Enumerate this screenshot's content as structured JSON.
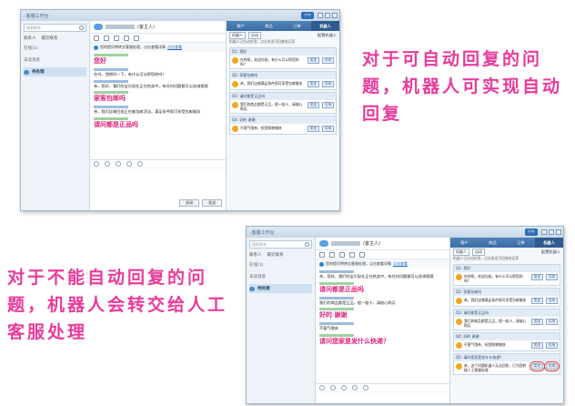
{
  "caption_top": "对于可自动回复的问题，机器人可实现自动回复",
  "caption_bottom": "对于不能自动回复的问题，机器人会转交给人工客服处理",
  "window1": {
    "title": "·客服工作台",
    "brand": "千牛",
    "sidebar": {
      "search_placeholder": "搜索联系",
      "tab_contacts": "联系人",
      "tab_recent": "最近联系",
      "items": [
        {
          "label": "在线(1)"
        },
        {
          "label": "未读消息"
        },
        {
          "label": "待处理"
        }
      ]
    },
    "chat": {
      "header_suffix": "(客主人)",
      "notice": "您的提问将转交客服处理，点击查看详情",
      "notice_link": "点击查看",
      "messages": [
        {
          "text": "您好",
          "big": true
        },
        {
          "text": "在吗，我想问一下，有什么可以帮您的吗？",
          "big": false
        },
        {
          "text": "亲，您好，我们的宝贝现在正在热卖中，有任何问题都可以咨询我哦",
          "big": false
        },
        {
          "text": "家客包邮吗",
          "big": true
        },
        {
          "text": "亲，我们店铺目前正在做包邮活动，满足条件即可享受包邮服务",
          "big": false
        },
        {
          "text": "请问都是正品吗",
          "big": true
        }
      ],
      "send_label": "发送",
      "close_label": "关闭"
    },
    "right": {
      "tabs": [
        "客户",
        "商品",
        "订单",
        "机器人"
      ],
      "sub_label": "机器人",
      "sub_mode": "自动",
      "settings": "配置机器人",
      "hint": "机器人已自动应答，点击发送可回复给买家",
      "qas": [
        {
          "title": "Q1: 您好",
          "answer": "在的呢，欢迎光临，有什么可以帮您的吗？"
        },
        {
          "title": "Q2: 家客包邮吗",
          "answer": "亲，我们店铺满足条件即可享受包邮服务"
        },
        {
          "title": "Q3: 请问都是正品吗",
          "answer": "我们的商品都是正品，假一赔十，请放心购买"
        },
        {
          "title": "Q4: 好的 谢谢",
          "answer": "不客气哦亲，祝您购物愉快"
        }
      ],
      "send": "发送",
      "edit": "引用"
    }
  },
  "window2": {
    "title": "·客服工作台",
    "brand": "千牛",
    "sidebar": {
      "search_placeholder": "搜索联系",
      "tab_contacts": "联系人",
      "tab_recent": "最近联系",
      "items": [
        {
          "label": "在线(1)"
        },
        {
          "label": "未读消息"
        },
        {
          "label": "待处理"
        }
      ]
    },
    "chat": {
      "header_suffix": "(客主人)",
      "notice": "您的提问将转交客服处理，点击查看详情",
      "notice_link": "点击查看",
      "messages": [
        {
          "text": "亲，您好，我们的宝贝现在正在热卖中，有任何问题都可以咨询我哦",
          "big": false
        },
        {
          "text": "请问都是正品吗",
          "big": true
        },
        {
          "text": "我们的商品都是正品，假一赔十，请放心购买",
          "big": false
        },
        {
          "text": "好的 谢谢",
          "big": true
        },
        {
          "text": "不客气哦亲",
          "big": false
        },
        {
          "text": "请问您家是发什么快递？",
          "big": true
        }
      ],
      "send_label": "发送",
      "close_label": "关闭"
    },
    "right": {
      "tabs": [
        "客户",
        "商品",
        "订单",
        "机器人"
      ],
      "sub_label": "机器人",
      "sub_mode": "自动",
      "settings": "配置机器人",
      "hint": "机器人已自动应答，点击发送可回复给买家",
      "qas": [
        {
          "title": "Q1: 您好",
          "answer": "在的呢，欢迎光临，有什么可以帮您的吗？"
        },
        {
          "title": "Q2: 家客包邮吗",
          "answer": "亲，我们店铺满足条件即可享受包邮服务"
        },
        {
          "title": "Q3: 请问都是正品吗",
          "answer": "我们的商品都是正品，假一赔十，请放心购买"
        },
        {
          "title": "Q4: 好的 谢谢",
          "answer": "不客气哦亲，祝您购物愉快"
        },
        {
          "title": "Q5: 请问您家是发什么快递？",
          "answer": "亲，这个问题机器人无法回答，已为您转接人工客服处理"
        }
      ],
      "send": "发送",
      "edit": "引用"
    }
  }
}
